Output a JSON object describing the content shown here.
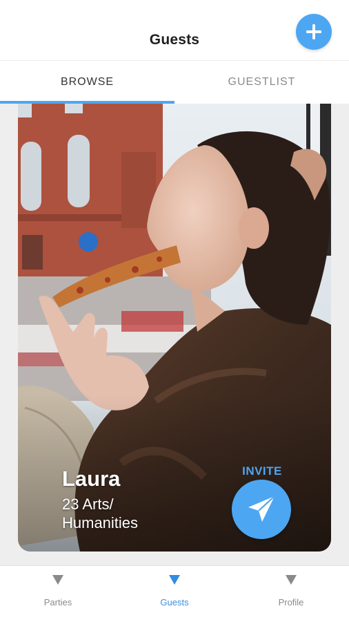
{
  "header": {
    "title": "Guests",
    "add_button_icon": "plus-icon"
  },
  "tabs": [
    {
      "label": "BROWSE",
      "active": true
    },
    {
      "label": "GUESTLIST",
      "active": false
    }
  ],
  "card": {
    "name": "Laura",
    "details": "23 Arts/ Humanities",
    "invite_label": "INVITE",
    "invite_icon": "paper-plane-icon"
  },
  "bottom_nav": [
    {
      "label": "Parties",
      "icon": "triangle-down-icon",
      "active": false
    },
    {
      "label": "Guests",
      "icon": "triangle-down-icon",
      "active": true
    },
    {
      "label": "Profile",
      "icon": "triangle-down-icon",
      "active": false
    }
  ],
  "colors": {
    "accent": "#4da6f2",
    "active_nav": "#3a8fe0",
    "inactive_text": "#8a8a8a"
  }
}
